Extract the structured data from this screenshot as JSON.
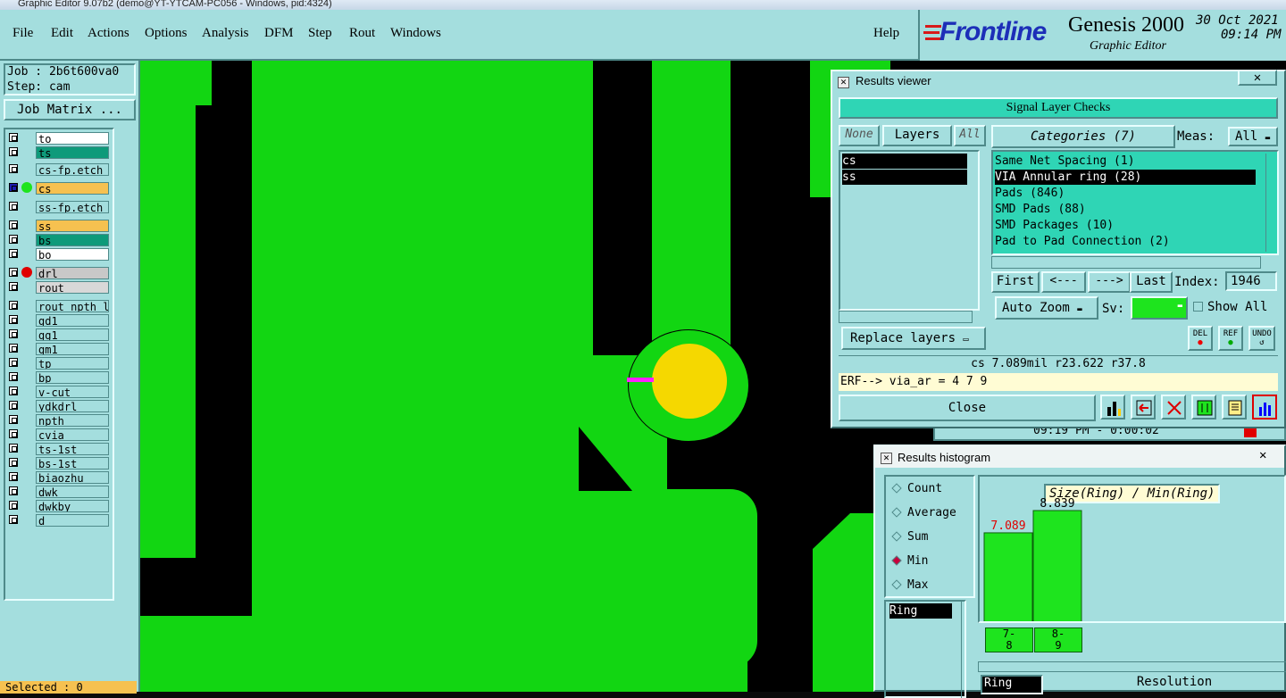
{
  "window": {
    "title": "Graphic Editor 9.07b2 (demo@YT-YTCAM-PC056 - Windows, pid:4324)"
  },
  "menu": [
    "File",
    "Edit",
    "Actions",
    "Options",
    "Analysis",
    "DFM",
    "Step",
    "Rout",
    "Windows"
  ],
  "help": "Help",
  "brand": {
    "logo": "Frontline",
    "product": "Genesis 2000",
    "subtitle": "Graphic Editor",
    "date": "30 Oct 2021",
    "time": "09:14 PM"
  },
  "left": {
    "job": "Job : 2b6t600va0",
    "step": "Step: cam",
    "job_matrix": "Job Matrix ...",
    "layers": [
      {
        "name": "to",
        "color": "#ffffff"
      },
      {
        "name": "ts",
        "color": "#0e9a7a"
      },
      {
        "name": "cs-fp.etch",
        "color": "#a4dede"
      },
      {
        "name": "cs",
        "color": "#f6c150"
      },
      {
        "name": "ss-fp.etch",
        "color": "#a4dede"
      },
      {
        "name": "ss",
        "color": "#f6c150"
      },
      {
        "name": "bs",
        "color": "#0e9a7a"
      },
      {
        "name": "bo",
        "color": "#ffffff"
      },
      {
        "name": "drl",
        "color": "#c8c8c8"
      },
      {
        "name": "rout",
        "color": "#d8d8d8"
      },
      {
        "name": "rout_npth_la",
        "color": "#a4dede"
      },
      {
        "name": "gd1",
        "color": "#a4dede"
      },
      {
        "name": "gg1",
        "color": "#a4dede"
      },
      {
        "name": "gm1",
        "color": "#a4dede"
      },
      {
        "name": "tp",
        "color": "#a4dede"
      },
      {
        "name": "bp",
        "color": "#a4dede"
      },
      {
        "name": "v-cut",
        "color": "#a4dede"
      },
      {
        "name": "ydkdrl",
        "color": "#a4dede"
      },
      {
        "name": "npth",
        "color": "#a4dede"
      },
      {
        "name": "cvia",
        "color": "#a4dede"
      },
      {
        "name": "ts-1st",
        "color": "#a4dede"
      },
      {
        "name": "bs-1st",
        "color": "#a4dede"
      },
      {
        "name": "biaozhu",
        "color": "#a4dede"
      },
      {
        "name": "dwk",
        "color": "#a4dede"
      },
      {
        "name": "dwkby",
        "color": "#a4dede"
      },
      {
        "name": "d",
        "color": "#a4dede"
      }
    ],
    "selected": "Selected : 0"
  },
  "results_viewer": {
    "title": "Results viewer",
    "header": "Signal Layer Checks",
    "none": "None",
    "layers_btn": "Layers",
    "all": "All",
    "layers": [
      "cs",
      "ss"
    ],
    "categories_btn": "Categories (7)",
    "meas_label": "Meas:",
    "meas_value": "All",
    "categories": [
      "Same Net Spacing (1)",
      "VIA Annular ring (28)",
      "Pads (846)",
      "SMD Pads (88)",
      "SMD Packages (10)",
      "Pad to Pad Connection (2)"
    ],
    "first": "First",
    "prev": "<---",
    "next": "--->",
    "last": "Last",
    "index_label": "Index:",
    "index_value": "1946",
    "auto_zoom": "Auto Zoom",
    "sv_label": "Sv:",
    "show_all": "Show All",
    "replace_layers": "Replace layers",
    "del": "DEL",
    "ref": "REF",
    "undo": "UNDO",
    "status": "cs 7.089mil  r23.622  r37.8",
    "erf": "ERF--> via_ar = 4 7 9",
    "close": "Close",
    "behind_text": "09:19 PM - 0:00:02"
  },
  "histogram": {
    "title": "Results histogram",
    "options": [
      "Count",
      "Average",
      "Sum",
      "Min",
      "Max"
    ],
    "selected": "Min",
    "list": [
      "Ring"
    ],
    "chart_title": "Size(Ring) / Min(Ring)",
    "bars": [
      {
        "label": "7-\n8",
        "value": 7.089,
        "value_text": "7.089"
      },
      {
        "label": "8-\n9",
        "value": 8.839,
        "value_text": "8.839"
      }
    ],
    "bottom_list": "Ring",
    "resolution": "Resolution"
  }
}
